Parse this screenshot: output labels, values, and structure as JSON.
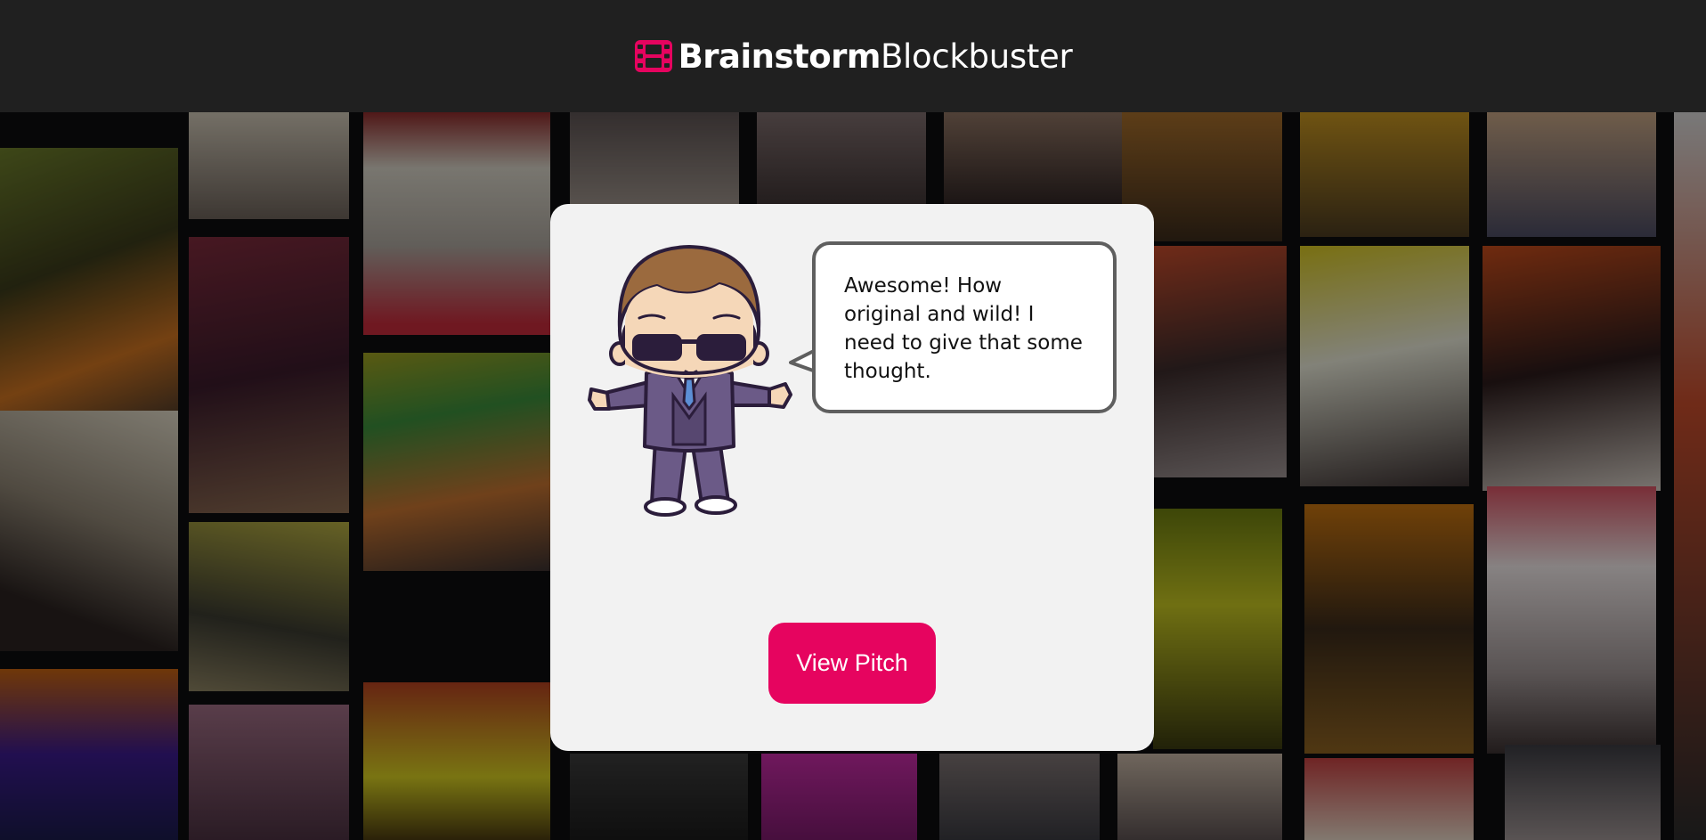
{
  "brand": {
    "name_bold": "Brainstorm",
    "name_light": "Blockbuster",
    "logo_icon": "film-icon",
    "accent_color": "#e6045f"
  },
  "dialog": {
    "speech": "Awesome! How original and wild! I need to give that some thought.",
    "mascot": "businessman-mascot-with-sunglasses",
    "action_label": "View Pitch"
  },
  "background": {
    "description_icon": "movie-poster-collage"
  }
}
